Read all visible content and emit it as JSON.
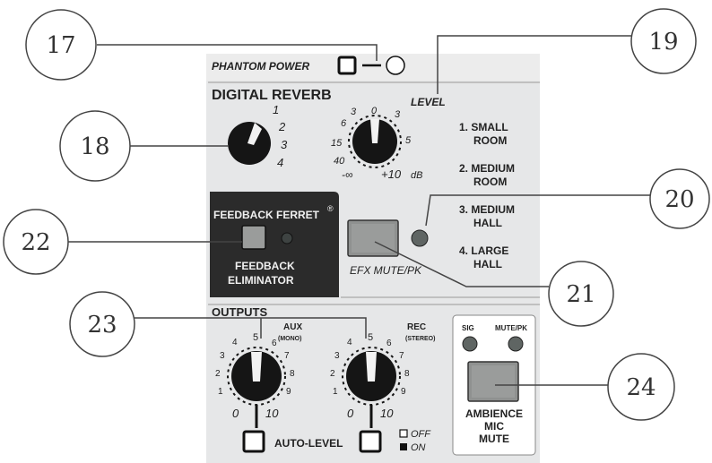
{
  "panel": {
    "phantom_power": "PHANTOM POWER",
    "digital_reverb": {
      "title": "DIGITAL REVERB",
      "level_label": "LEVEL",
      "select_ticks": [
        "1",
        "2",
        "3",
        "4"
      ],
      "level_ticks": [
        "0",
        "3",
        "3",
        "6",
        "5",
        "15",
        "40",
        "-∞",
        "+10",
        "dB"
      ],
      "presets": [
        {
          "num": "1.",
          "line1": "SMALL",
          "line2": "ROOM"
        },
        {
          "num": "2.",
          "line1": "MEDIUM",
          "line2": "ROOM"
        },
        {
          "num": "3.",
          "line1": "MEDIUM",
          "line2": "HALL"
        },
        {
          "num": "4.",
          "line1": "LARGE",
          "line2": "HALL"
        }
      ],
      "efx_mute": "EFX MUTE/PK"
    },
    "feedback": {
      "brand": "FEEDBACK FERRET",
      "reg": "®",
      "line1": "FEEDBACK",
      "line2": "ELIMINATOR"
    },
    "outputs": {
      "title": "OUTPUTS",
      "aux_label": "AUX",
      "aux_sub": "(MONO)",
      "rec_label": "REC",
      "rec_sub": "(STEREO)",
      "scale": [
        "0",
        "1",
        "2",
        "3",
        "4",
        "5",
        "6",
        "7",
        "8",
        "9",
        "10"
      ],
      "auto_level": "AUTO-LEVEL",
      "off": "OFF",
      "on": "ON"
    },
    "ambience": {
      "sig": "SIG",
      "mute_pk": "MUTE/PK",
      "line1": "AMBIENCE",
      "line2": "MIC",
      "line3": "MUTE"
    }
  },
  "callouts": [
    "17",
    "18",
    "19",
    "20",
    "21",
    "22",
    "23",
    "24"
  ],
  "colors": {
    "panel": "#e4e5e6",
    "knob": "#141414",
    "dark_block": "#2b2b2b",
    "button": "#8f9190",
    "led": "#5f6563",
    "line": "#444444"
  }
}
